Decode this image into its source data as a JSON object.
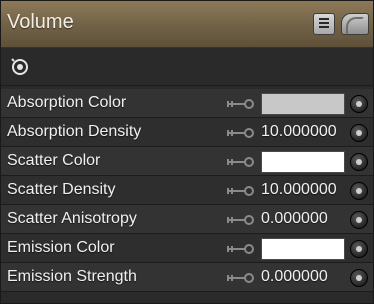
{
  "panel": {
    "title": "Volume",
    "toolbar": {
      "list_icon": "list-icon",
      "page_icon": "page-curl-icon"
    },
    "icon_row": {
      "icon": "target-cycle-icon"
    },
    "rows": [
      {
        "label": "Absorption Color",
        "kind": "color",
        "color": "#c8c8c8"
      },
      {
        "label": "Absorption Density",
        "kind": "number",
        "value": "10.000000"
      },
      {
        "label": "Scatter Color",
        "kind": "color",
        "color": "#ffffff"
      },
      {
        "label": "Scatter Density",
        "kind": "number",
        "value": "10.000000"
      },
      {
        "label": "Scatter Anisotropy",
        "kind": "number",
        "value": "0.000000"
      },
      {
        "label": "Emission Color",
        "kind": "color",
        "color": "#ffffff"
      },
      {
        "label": "Emission Strength",
        "kind": "number",
        "value": "0.000000"
      }
    ]
  }
}
